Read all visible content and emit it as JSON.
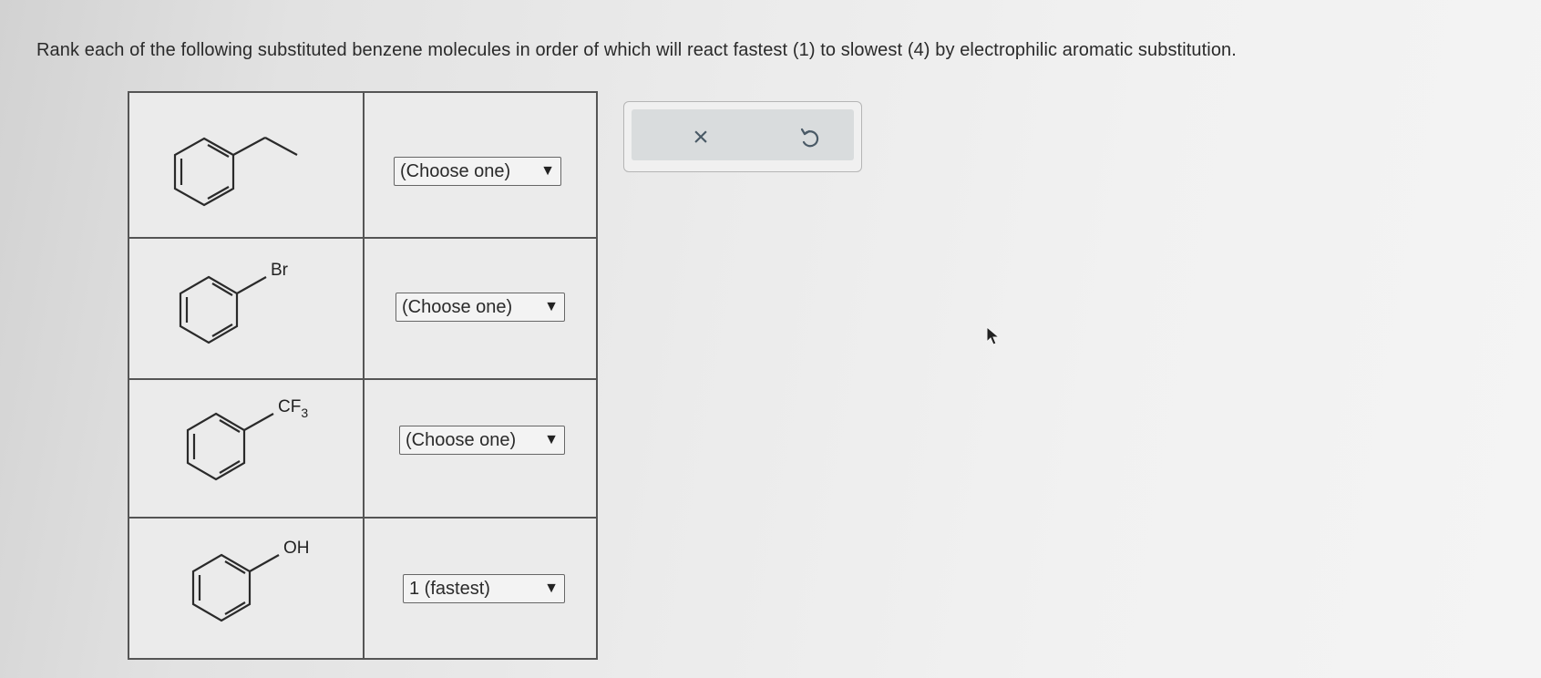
{
  "question": {
    "text": "Rank each of the following substituted benzene molecules in order of which will react fastest (1) to slowest (4) by electrophilic aromatic substitution."
  },
  "rows": [
    {
      "substituent": "",
      "substituent_sub": "",
      "selected": "(Choose one)"
    },
    {
      "substituent": "Br",
      "substituent_sub": "",
      "selected": "(Choose one)"
    },
    {
      "substituent": "CF",
      "substituent_sub": "3",
      "selected": "(Choose one)"
    },
    {
      "substituent": "OH",
      "substituent_sub": "",
      "selected": "1 (fastest)"
    }
  ],
  "icons": {
    "dropdown": "dropdown-triangle-icon",
    "clear": "close-icon",
    "undo": "undo-icon",
    "cursor": "mouse-pointer-icon"
  },
  "actions": {
    "clear_glyph": "×"
  }
}
